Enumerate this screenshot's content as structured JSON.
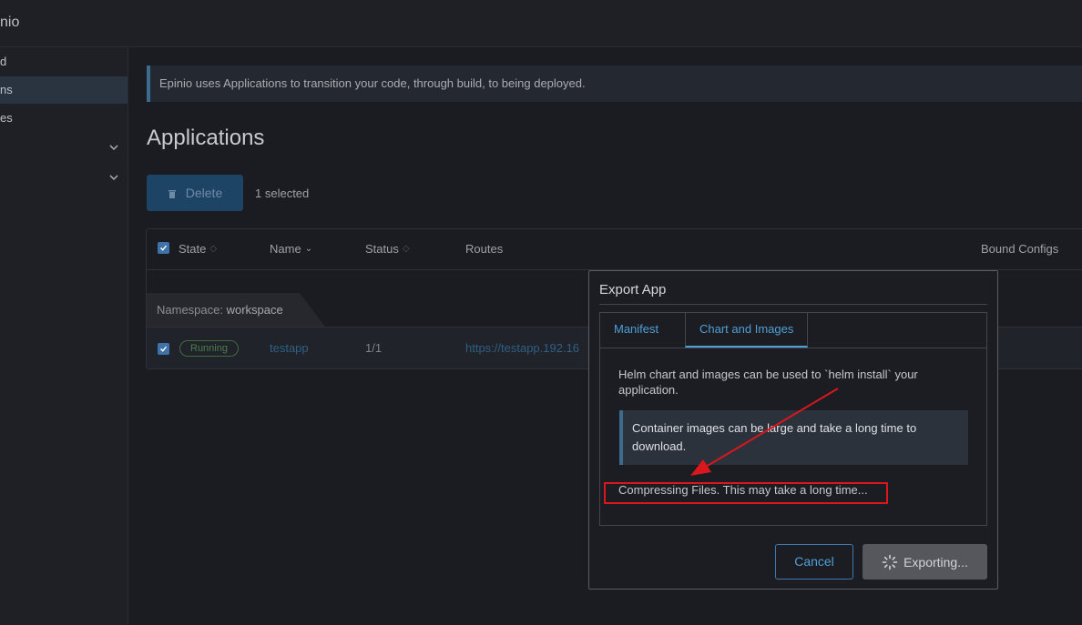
{
  "app": {
    "brand_partial": "nio"
  },
  "sidebar": {
    "items": [
      {
        "label": "d"
      },
      {
        "label": "ns"
      },
      {
        "label": "es"
      }
    ]
  },
  "banner": {
    "text": "Epinio uses Applications to transition your code, through build, to being deployed."
  },
  "page": {
    "title": "Applications"
  },
  "toolbar": {
    "delete_label": "Delete",
    "selected_text": "1 selected"
  },
  "table": {
    "headers": [
      "State",
      "Name",
      "Status",
      "Routes",
      "Bound Configs"
    ],
    "namespace_label": "Namespace:",
    "namespace_value": "workspace",
    "rows": [
      {
        "state": "Running",
        "name": "testapp",
        "status": "1/1",
        "route": "https://testapp.192.16"
      }
    ]
  },
  "modal": {
    "title": "Export App",
    "tabs": [
      "Manifest",
      "Chart and Images"
    ],
    "active_tab": "Chart and Images",
    "description": "Helm chart and images can be used to `helm install` your application.",
    "warning": "Container images can be large and take a long time to download.",
    "progress": "Compressing Files. This may take a long time...",
    "cancel_label": "Cancel",
    "export_label": "Exporting..."
  },
  "colors": {
    "accent": "#4f9fd7",
    "highlight_red": "#d9171c",
    "success": "#4d7d4d"
  }
}
